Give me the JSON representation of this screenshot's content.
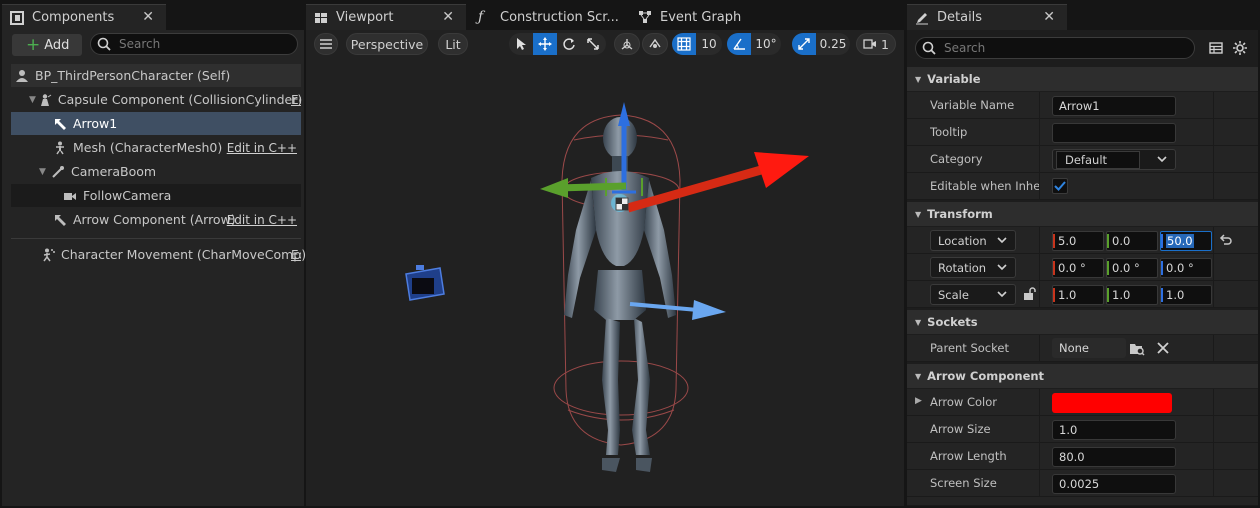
{
  "components_panel": {
    "tab_title": "Components",
    "add_label": "Add",
    "search_placeholder": "Search",
    "tree": [
      {
        "label": "BP_ThirdPersonCharacter (Self)",
        "icon": "person-icon"
      },
      {
        "label": "Capsule Component (CollisionCylinder)",
        "icon": "capsule-icon",
        "edit": "Edit in C++"
      },
      {
        "label": "Arrow1",
        "icon": "arrow-icon",
        "selected": true
      },
      {
        "label": "Mesh (CharacterMesh0)",
        "icon": "skeleton-icon",
        "edit": "Edit in C++"
      },
      {
        "label": "CameraBoom",
        "icon": "spring-arm-icon"
      },
      {
        "label": "FollowCamera",
        "icon": "camera-icon"
      },
      {
        "label": "Arrow Component (Arrow)",
        "icon": "arrow-icon",
        "edit": "Edit in C++"
      },
      {
        "label": "Character Movement (CharMoveComp)",
        "icon": "movement-icon",
        "edit": "Edit in C++"
      }
    ]
  },
  "viewport": {
    "tabs": [
      {
        "label": "Viewport",
        "icon": "viewport-grid-icon",
        "active": true
      },
      {
        "label": "Construction Scr...",
        "icon": "function-icon"
      },
      {
        "label": "Event Graph",
        "icon": "graph-icon"
      }
    ],
    "toolbar": {
      "perspective": "Perspective",
      "lit": "Lit",
      "grid_snap": "10",
      "rotation_snap": "10°",
      "scale_snap": "0.25",
      "camera_speed": "1"
    }
  },
  "details": {
    "tab_title": "Details",
    "search_placeholder": "Search",
    "sections": {
      "variable": "Variable",
      "transform": "Transform",
      "sockets": "Sockets",
      "arrow_component": "Arrow Component"
    },
    "variable": {
      "name_label": "Variable Name",
      "name_value": "Arrow1",
      "tooltip_label": "Tooltip",
      "tooltip_value": "",
      "category_label": "Category",
      "category_value": "Default",
      "editable_label": "Editable when Inheri...",
      "editable_checked": true
    },
    "transform": {
      "location_label": "Location",
      "location": [
        "5.0",
        "0.0",
        "50.0"
      ],
      "rotation_label": "Rotation",
      "rotation": [
        "0.0 °",
        "0.0 °",
        "0.0 °"
      ],
      "scale_label": "Scale",
      "scale": [
        "1.0",
        "1.0",
        "1.0"
      ]
    },
    "sockets": {
      "parent_label": "Parent Socket",
      "parent_value": "None"
    },
    "arrow": {
      "color_label": "Arrow Color",
      "color_value": "#ff0000",
      "size_label": "Arrow Size",
      "size_value": "1.0",
      "length_label": "Arrow Length",
      "length_value": "80.0",
      "screen_size_label": "Screen Size",
      "screen_size_value": "0.0025"
    }
  },
  "colors": {
    "accent": "#1a6fc9",
    "selection": "#3f4f63",
    "x_axis": "#c8341c",
    "y_axis": "#5aa02c",
    "z_axis": "#2d6fe0"
  }
}
